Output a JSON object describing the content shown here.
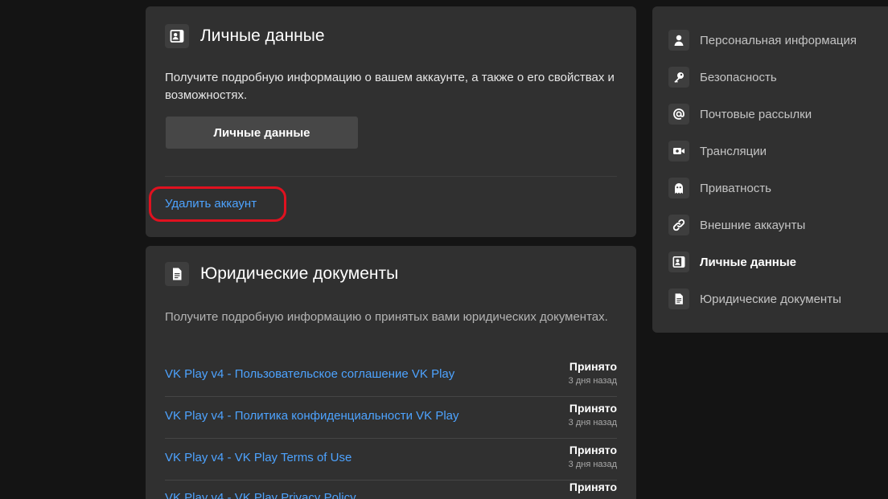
{
  "personal_card": {
    "title": "Личные данные",
    "icon": "contact-card-icon",
    "description": "Получите подробную информацию о вашем аккаунте, а также о его свойствах и возможностях.",
    "button_label": "Личные данные",
    "delete_link": "Удалить аккаунт"
  },
  "legal_card": {
    "title": "Юридические документы",
    "icon": "document-icon",
    "description": "Получите подробную информацию о принятых вами юридических документах.",
    "documents": [
      {
        "title": "VK Play v4 - Пользовательское соглашение VK Play",
        "status": "Принято",
        "time": "3 дня назад"
      },
      {
        "title": "VK Play v4 - Политика конфиденциальности VK Play",
        "status": "Принято",
        "time": "3 дня назад"
      },
      {
        "title": "VK Play v4 - VK Play Terms of Use",
        "status": "Принято",
        "time": "3 дня назад"
      },
      {
        "title": "VK Play v4 - VK Play Privacy Policy",
        "status": "Принято",
        "time": ""
      }
    ]
  },
  "sidebar": {
    "items": [
      {
        "label": "Персональная информация",
        "icon": "person-icon",
        "active": false
      },
      {
        "label": "Безопасность",
        "icon": "key-icon",
        "active": false
      },
      {
        "label": "Почтовые рассылки",
        "icon": "at-sign-icon",
        "active": false
      },
      {
        "label": "Трансляции",
        "icon": "video-camera-icon",
        "active": false
      },
      {
        "label": "Приватность",
        "icon": "ghost-icon",
        "active": false
      },
      {
        "label": "Внешние аккаунты",
        "icon": "link-icon",
        "active": false
      },
      {
        "label": "Личные данные",
        "icon": "contact-card-icon",
        "active": true
      },
      {
        "label": "Юридические документы",
        "icon": "document-icon",
        "active": false
      }
    ]
  },
  "colors": {
    "background": "#141414",
    "card": "#303030",
    "link": "#4da3ff",
    "highlight": "#e0111f"
  }
}
